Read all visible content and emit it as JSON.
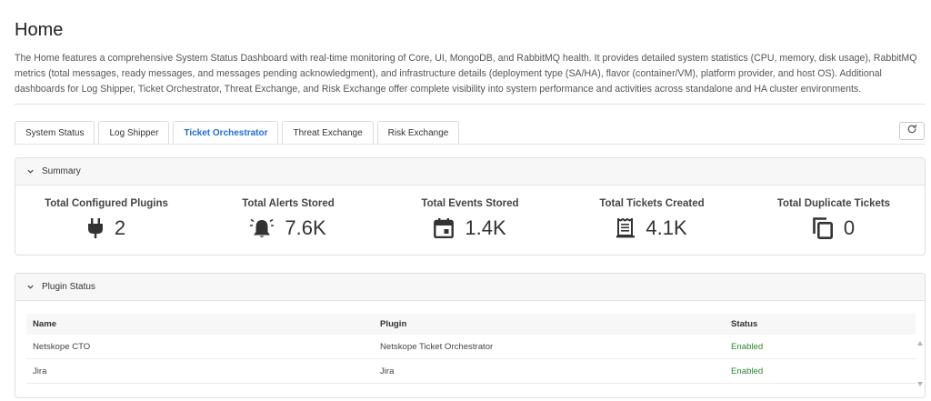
{
  "page": {
    "title": "Home",
    "description": "The Home features a comprehensive System Status Dashboard with real-time monitoring of Core, UI, MongoDB, and RabbitMQ health. It provides detailed system statistics (CPU, memory, disk usage), RabbitMQ metrics (total messages, ready messages, and messages pending acknowledgment), and infrastructure details (deployment type (SA/HA), flavor (container/VM), platform provider, and host OS). Additional dashboards for Log Shipper, Ticket Orchestrator, Threat Exchange, and Risk Exchange offer complete visibility into system performance and activities across standalone and HA cluster environments."
  },
  "tabs": [
    {
      "label": "System Status",
      "active": false
    },
    {
      "label": "Log Shipper",
      "active": false
    },
    {
      "label": "Ticket Orchestrator",
      "active": true
    },
    {
      "label": "Threat Exchange",
      "active": false
    },
    {
      "label": "Risk Exchange",
      "active": false
    }
  ],
  "toolbar": {
    "refresh_icon": "refresh-icon"
  },
  "summary": {
    "title": "Summary",
    "stats": [
      {
        "label": "Total Configured Plugins",
        "value": "2",
        "icon": "plug-icon"
      },
      {
        "label": "Total Alerts Stored",
        "value": "7.6K",
        "icon": "alarm-bell-icon"
      },
      {
        "label": "Total Events Stored",
        "value": "1.4K",
        "icon": "calendar-icon"
      },
      {
        "label": "Total Tickets Created",
        "value": "4.1K",
        "icon": "receipt-icon"
      },
      {
        "label": "Total Duplicate Tickets",
        "value": "0",
        "icon": "copy-icon"
      }
    ]
  },
  "plugin_status": {
    "title": "Plugin Status",
    "columns": [
      "Name",
      "Plugin",
      "Status"
    ],
    "rows": [
      {
        "name": "Netskope CTO",
        "plugin": "Netskope Ticket Orchestrator",
        "status": "Enabled"
      },
      {
        "name": "Jira",
        "plugin": "Jira",
        "status": "Enabled"
      }
    ]
  },
  "colors": {
    "accent": "#1f6fd0",
    "enabled": "#2b8a2b"
  }
}
